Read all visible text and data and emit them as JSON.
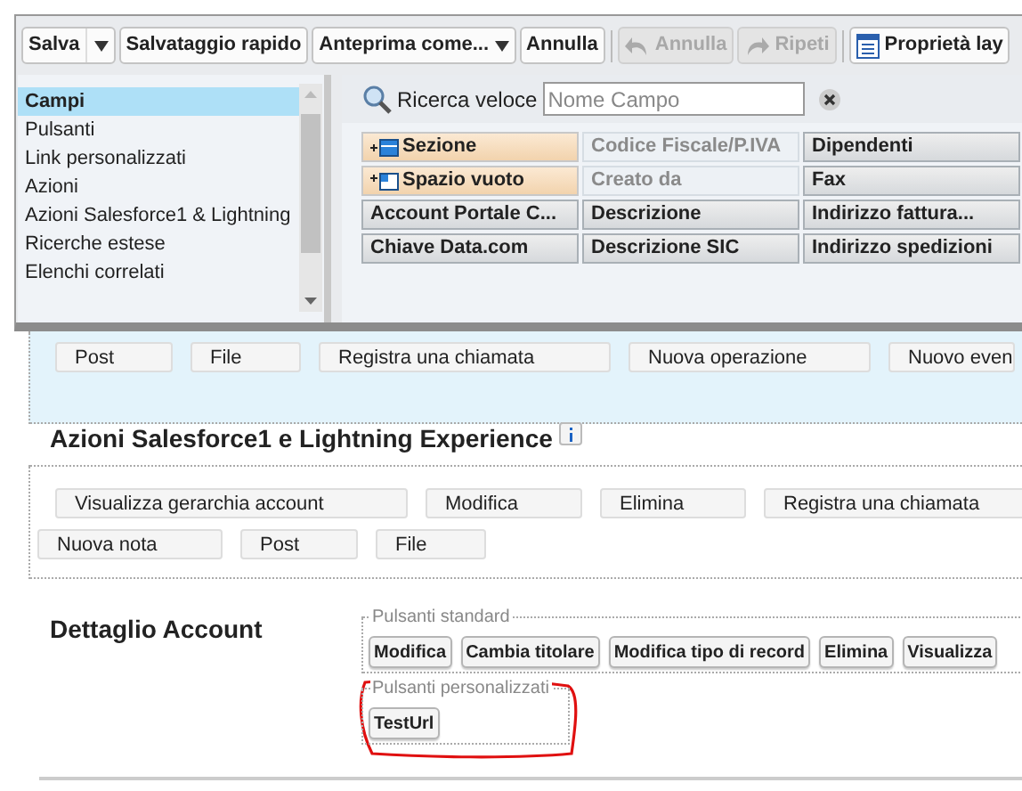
{
  "toolbar": {
    "groups": [
      [
        {
          "label": "Salva",
          "kind": "split",
          "disabled": false
        },
        {
          "label": "Salvataggio rapido",
          "kind": "plain",
          "disabled": false
        },
        {
          "label": "Anteprima come...",
          "kind": "dropdown",
          "disabled": false
        },
        {
          "label": "Annulla",
          "kind": "plain",
          "disabled": false
        }
      ],
      [
        {
          "label": "Annulla",
          "kind": "undo",
          "disabled": true
        },
        {
          "label": "Ripeti",
          "kind": "redo",
          "disabled": true
        }
      ],
      [
        {
          "label": "Proprietà lay",
          "kind": "properties",
          "disabled": false
        }
      ]
    ]
  },
  "palette": {
    "categories": [
      {
        "label": "Campi",
        "selected": true
      },
      {
        "label": "Pulsanti",
        "selected": false
      },
      {
        "label": "Link personalizzati",
        "selected": false
      },
      {
        "label": "Azioni",
        "selected": false
      },
      {
        "label": "Azioni Salesforce1 & Lightning",
        "selected": false
      },
      {
        "label": "Ricerche estese",
        "selected": false
      },
      {
        "label": "Elenchi correlati",
        "selected": false
      }
    ],
    "quick_find": {
      "label": "Ricerca veloce",
      "placeholder": "Nome Campo"
    },
    "items": [
      {
        "label": "Sezione",
        "kind": "section",
        "disabled": false
      },
      {
        "label": "Codice Fiscale/P.IVA",
        "kind": "field",
        "disabled": true
      },
      {
        "label": "Dipendenti",
        "kind": "field",
        "disabled": false
      },
      {
        "label": "Spazio vuoto",
        "kind": "blank",
        "disabled": false
      },
      {
        "label": "Creato da",
        "kind": "field",
        "disabled": true
      },
      {
        "label": "Fax",
        "kind": "field",
        "disabled": false
      },
      {
        "label": "Account Portale C...",
        "kind": "field",
        "disabled": false
      },
      {
        "label": "Descrizione",
        "kind": "field",
        "disabled": false
      },
      {
        "label": "Indirizzo fattura...",
        "kind": "field",
        "disabled": false
      },
      {
        "label": "Chiave Data.com",
        "kind": "field",
        "disabled": false
      },
      {
        "label": "Descrizione SIC",
        "kind": "field",
        "disabled": false
      },
      {
        "label": "Indirizzo spedizioni",
        "kind": "field",
        "disabled": false
      }
    ]
  },
  "publisher_actions": [
    "Post",
    "File",
    "Registra una chiamata",
    "Nuova operazione",
    "Nuovo even"
  ],
  "lightning_actions": {
    "title": "Azioni Salesforce1 e Lightning Experience",
    "actions": [
      "Visualizza gerarchia account",
      "Modifica",
      "Elimina",
      "Registra una chiamata",
      "Nuova nota",
      "Post",
      "File"
    ]
  },
  "account_detail": {
    "title": "Dettaglio Account",
    "standard_buttons": {
      "legend": "Pulsanti standard",
      "buttons": [
        "Modifica",
        "Cambia titolare",
        "Modifica tipo di record",
        "Elimina",
        "Visualizza"
      ]
    },
    "custom_buttons": {
      "legend": "Pulsanti personalizzati",
      "buttons": [
        "TestUrl"
      ]
    }
  }
}
